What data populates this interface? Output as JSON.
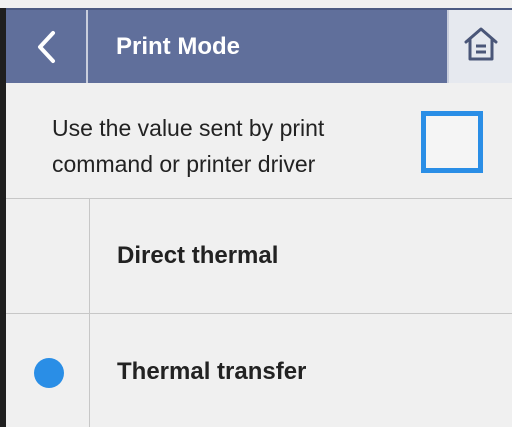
{
  "header": {
    "back_icon": "chevron-left-icon",
    "title": "Print Mode",
    "home_icon": "home-icon"
  },
  "override": {
    "label": "Use the value sent by print\ncommand or printer driver",
    "checked": false
  },
  "options": [
    {
      "label": "Direct thermal",
      "selected": false
    },
    {
      "label": "Thermal transfer",
      "selected": true
    }
  ],
  "colors": {
    "header_bg": "#606f9b",
    "accent": "#2a8ee6",
    "background": "#f0f0f0"
  }
}
